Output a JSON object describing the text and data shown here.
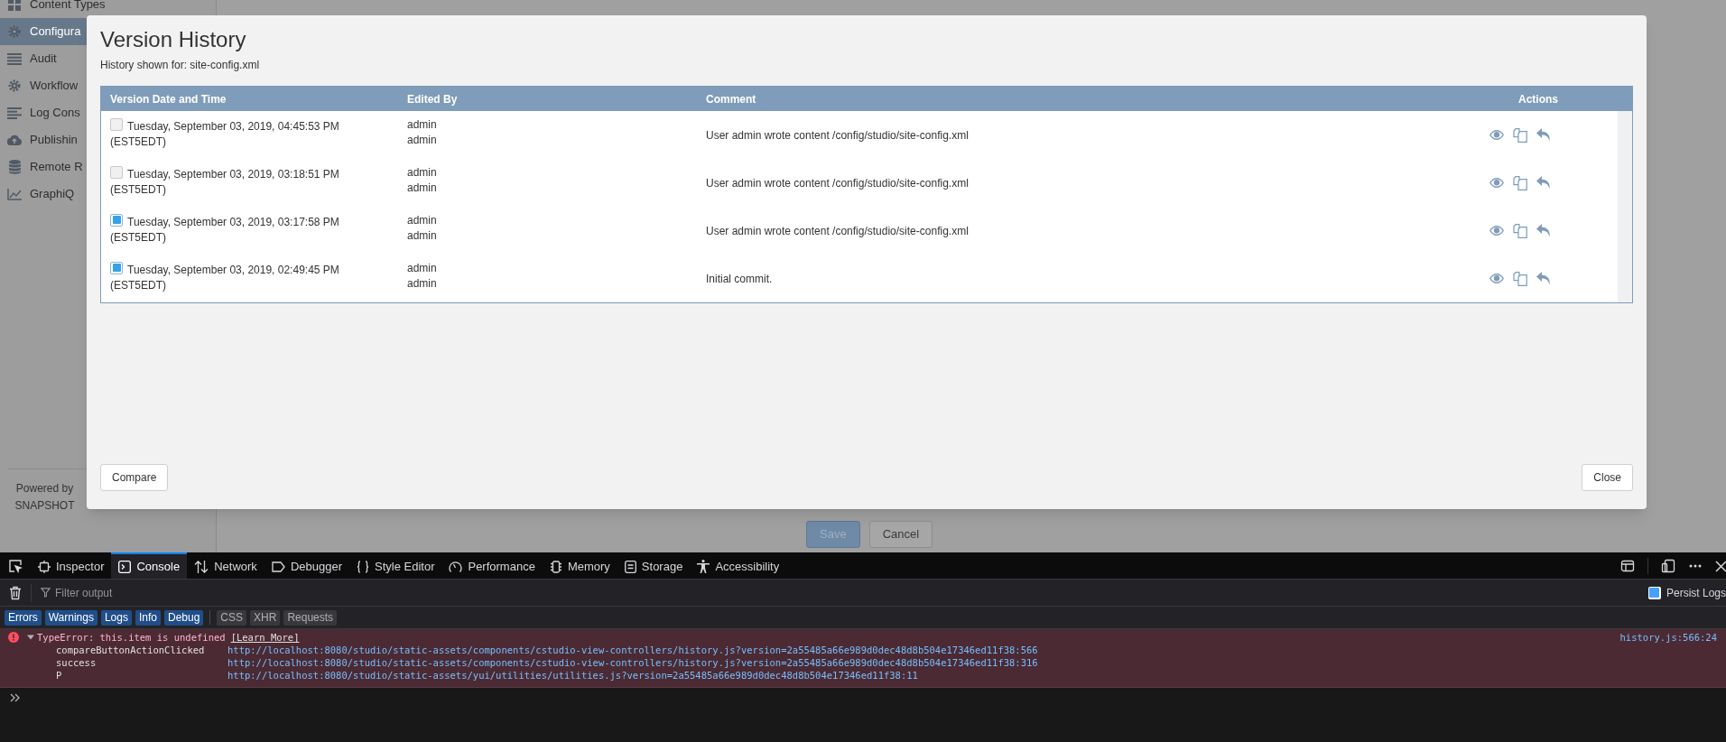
{
  "background_page": {
    "sidebar": {
      "items": [
        {
          "label": "Content Types",
          "selected": false
        },
        {
          "label": "Configura",
          "selected": true
        },
        {
          "label": "Audit",
          "selected": false
        },
        {
          "label": "Workflow",
          "selected": false
        },
        {
          "label": "Log Cons",
          "selected": false
        },
        {
          "label": "Publishin",
          "selected": false
        },
        {
          "label": "Remote R",
          "selected": false
        },
        {
          "label": "GraphiQ",
          "selected": false
        }
      ],
      "footer": [
        "Powered by",
        "SNAPSHOT"
      ]
    },
    "buttons": [
      {
        "label": "Save",
        "disabled": true
      },
      {
        "label": "Cancel",
        "disabled": false
      }
    ]
  },
  "dialog": {
    "title": "Version History",
    "subtitle": "History shown for: site-config.xml",
    "table": {
      "columns": [
        "Version Date and Time",
        "Edited By",
        "Comment",
        "Actions"
      ],
      "rows": [
        {
          "checked": false,
          "date": "Tuesday, September 03, 2019, 04:45:53 PM",
          "timezone": "(EST5EDT)",
          "edited_by": [
            "admin",
            "admin"
          ],
          "comment": "User admin wrote content /config/studio/site-config.xml"
        },
        {
          "checked": false,
          "date": "Tuesday, September 03, 2019, 03:18:51 PM",
          "timezone": "(EST5EDT)",
          "edited_by": [
            "admin",
            "admin"
          ],
          "comment": "User admin wrote content /config/studio/site-config.xml"
        },
        {
          "checked": true,
          "date": "Tuesday, September 03, 2019, 03:17:58 PM",
          "timezone": "(EST5EDT)",
          "edited_by": [
            "admin",
            "admin"
          ],
          "comment": "User admin wrote content /config/studio/site-config.xml"
        },
        {
          "checked": true,
          "date": "Tuesday, September 03, 2019, 02:49:45 PM",
          "timezone": "(EST5EDT)",
          "edited_by": [
            "admin",
            "admin"
          ],
          "comment": "Initial commit."
        }
      ]
    },
    "buttons": [
      "Compare",
      "Close"
    ]
  },
  "devtools": {
    "tabs": [
      {
        "label": "Inspector",
        "selected": false
      },
      {
        "label": "Console",
        "selected": true
      },
      {
        "label": "Network",
        "selected": false
      },
      {
        "label": "Debugger",
        "selected": false
      },
      {
        "label": "Style Editor",
        "selected": false
      },
      {
        "label": "Performance",
        "selected": false
      },
      {
        "label": "Memory",
        "selected": false
      },
      {
        "label": "Storage",
        "selected": false
      },
      {
        "label": "Accessibility",
        "selected": false
      }
    ],
    "filter": {
      "placeholder": "Filter output"
    },
    "persist_logs": {
      "label": "Persist Logs",
      "checked": true
    },
    "filters": [
      {
        "label": "Errors",
        "selected": true
      },
      {
        "label": "Warnings",
        "selected": true
      },
      {
        "label": "Logs",
        "selected": true
      },
      {
        "label": "Info",
        "selected": true
      },
      {
        "label": "Debug",
        "selected": true
      },
      {
        "label": "CSS",
        "selected": false
      },
      {
        "label": "XHR",
        "selected": false
      },
      {
        "label": "Requests",
        "selected": false
      }
    ],
    "messages": [
      {
        "kind": "error",
        "expanded": true,
        "text": "TypeError: this.item is undefined",
        "link": "[Learn More]",
        "location": "history.js:566:24",
        "stack": [
          {
            "function": "compareButtonActionClicked",
            "url": "http://localhost:8080/studio/static-assets/components/cstudio-view-controllers/history.js?version=2a55485a66e989d0dec48d8b504e17346ed11f38:566"
          },
          {
            "function": "success",
            "url": "http://localhost:8080/studio/static-assets/components/cstudio-view-controllers/history.js?version=2a55485a66e989d0dec48d8b504e17346ed11f38:316"
          },
          {
            "function": "P",
            "url": "http://localhost:8080/studio/static-assets/yui/utilities/utilities.js?version=2a55485a66e989d0dec48d8b504e17346ed11f38:11"
          }
        ]
      }
    ]
  }
}
